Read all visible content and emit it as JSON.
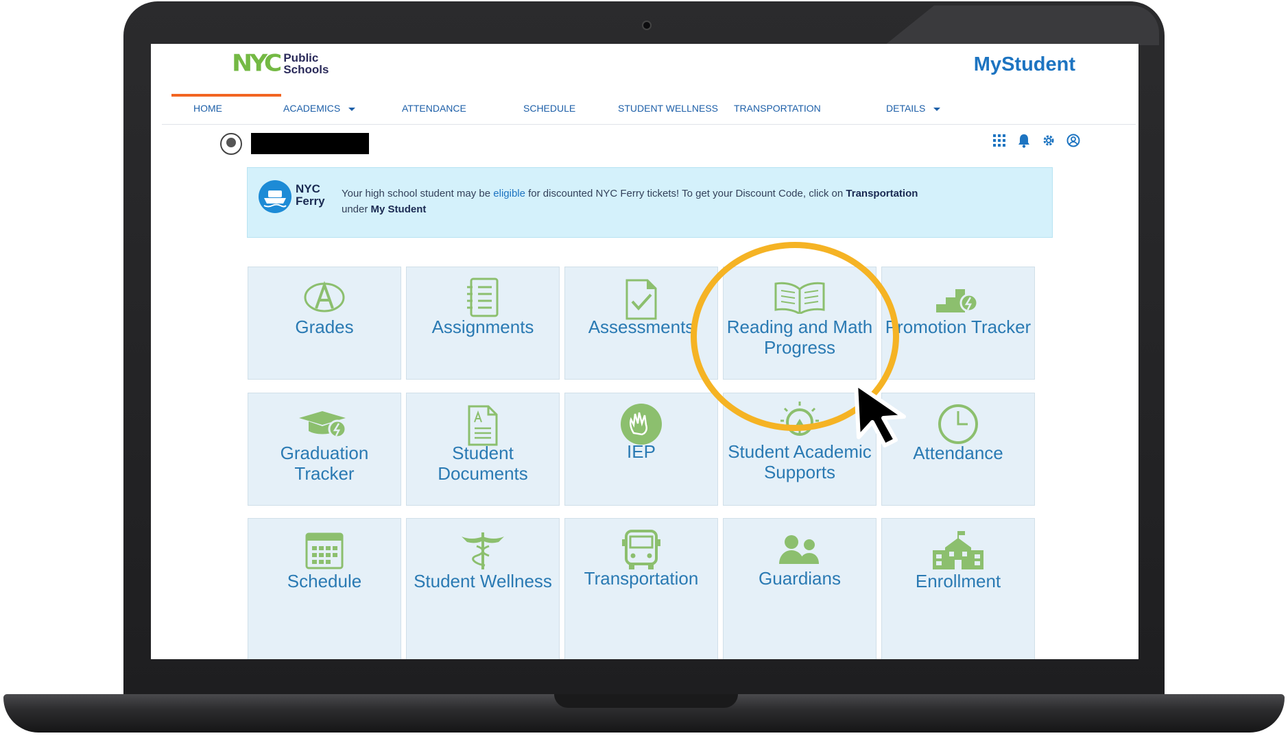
{
  "app": {
    "title": "MyStudent"
  },
  "logo": {
    "nyc": "NYC",
    "line1": "Public",
    "line2": "Schools"
  },
  "nav": [
    {
      "label": "HOME",
      "dropdown": false,
      "active": true
    },
    {
      "label": "ACADEMICS",
      "dropdown": true,
      "active": false
    },
    {
      "label": "ATTENDANCE",
      "dropdown": false,
      "active": false
    },
    {
      "label": "SCHEDULE",
      "dropdown": false,
      "active": false
    },
    {
      "label": "STUDENT WELLNESS",
      "dropdown": false,
      "active": false
    },
    {
      "label": "TRANSPORTATION",
      "dropdown": false,
      "active": false
    },
    {
      "label": "DETAILS",
      "dropdown": true,
      "active": false
    }
  ],
  "tools": [
    "grid-icon",
    "bell-icon",
    "gear-icon",
    "user-circle-icon"
  ],
  "banner": {
    "logo_line1": "NYC",
    "logo_line2": "Ferry",
    "text_before_link": "Your high school student may be ",
    "link": "eligible",
    "text_after_link": " for discounted NYC Ferry tickets! To get your Discount Code, click on ",
    "bold1": "Transportation",
    "text_mid": "under ",
    "bold2": "My Student"
  },
  "tiles": [
    {
      "label": "Grades",
      "icon": "grade-a-icon"
    },
    {
      "label": "Assignments",
      "icon": "checklist-icon"
    },
    {
      "label": "Assessments",
      "icon": "document-check-icon"
    },
    {
      "label": "Reading and Math Progress",
      "icon": "open-book-icon"
    },
    {
      "label": "Promotion Tracker",
      "icon": "stairs-icon"
    },
    {
      "label": "Graduation Tracker",
      "icon": "graduation-cap-icon"
    },
    {
      "label": "Student Documents",
      "icon": "document-icon"
    },
    {
      "label": "IEP",
      "icon": "hands-icon"
    },
    {
      "label": "Student Academic Supports",
      "icon": "lightbulb-icon"
    },
    {
      "label": "Attendance",
      "icon": "clock-icon"
    },
    {
      "label": "Schedule",
      "icon": "calendar-icon"
    },
    {
      "label": "Student Wellness",
      "icon": "caduceus-icon"
    },
    {
      "label": "Transportation",
      "icon": "bus-icon"
    },
    {
      "label": "Guardians",
      "icon": "people-icon"
    },
    {
      "label": "Enrollment",
      "icon": "school-building-icon"
    }
  ],
  "colors": {
    "accent": "#1d74c1",
    "tile_bg": "#e5f0f8",
    "icon_green": "#8cbf6e",
    "highlight": "#f5b324",
    "active_tab": "#f26522"
  }
}
